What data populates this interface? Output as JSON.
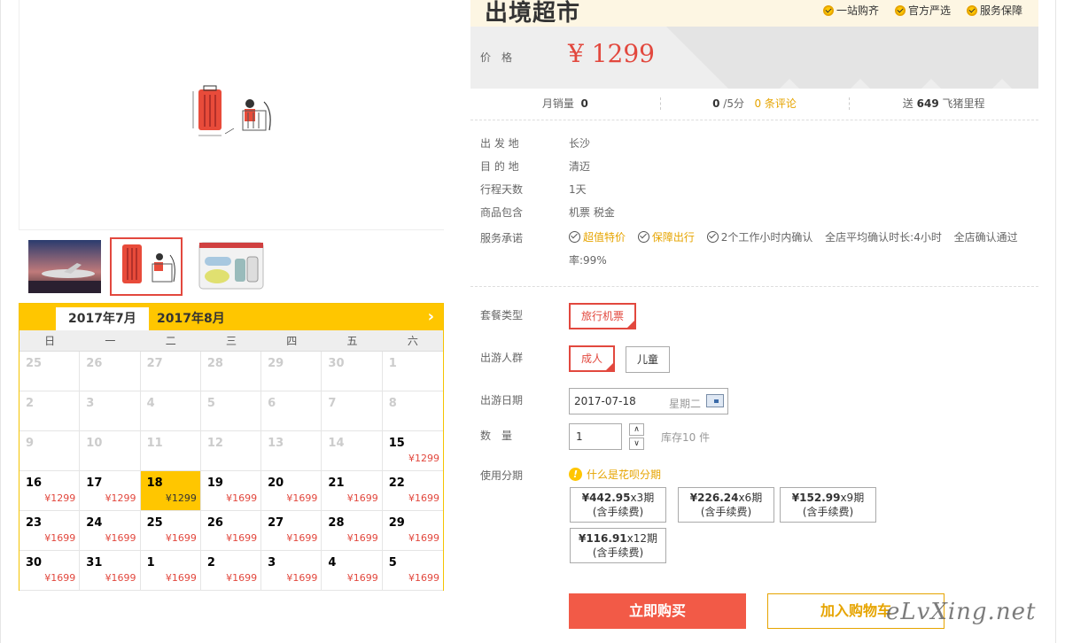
{
  "brand": {
    "logo_text": "出境超市",
    "badges": [
      "一站购齐",
      "官方严选",
      "服务保障"
    ]
  },
  "price": {
    "label": "价格",
    "value": "¥ 1299"
  },
  "stats": {
    "sales_label": "月销量",
    "sales_value": "0",
    "score_value": "0",
    "score_unit": "/5分",
    "reviews_link": "0 条评论",
    "miles_prefix": "送",
    "miles_value": "649",
    "miles_suffix": "飞猪里程"
  },
  "info": [
    {
      "key": "出 发 地",
      "value": "长沙"
    },
    {
      "key": "目 的 地",
      "value": "清迈"
    },
    {
      "key": "行程天数",
      "value": "1天"
    },
    {
      "key": "商品包含",
      "value": "机票  税金"
    }
  ],
  "promise": {
    "label": "服务承诺",
    "items": [
      {
        "text": "超值特价",
        "highlight": true,
        "icon": "check-circle-icon"
      },
      {
        "text": "保障出行",
        "highlight": true,
        "icon": "check-circle-icon"
      },
      {
        "text": "2个工作小时内确认",
        "highlight": false,
        "icon": "check-circle-icon"
      }
    ],
    "extra1": "全店平均确认时长:4小时",
    "extra2": "全店确认通过率:99%"
  },
  "options": {
    "package_label": "套餐类型",
    "package_value": "旅行机票",
    "crowd_label": "出游人群",
    "crowd_adult": "成人",
    "crowd_child": "儿童",
    "date_label": "出游日期",
    "date_value": "2017-07-18",
    "date_weekday": "星期二",
    "qty_label": "数　量",
    "qty_value": "1",
    "stock": "库存10 件",
    "installment_label": "使用分期",
    "huabei_link": "什么是花呗分期",
    "installments": [
      {
        "amount": "¥442.95",
        "term": "x3期",
        "fee": "(含手续费)"
      },
      {
        "amount": "¥226.24",
        "term": "x6期",
        "fee": "(含手续费)"
      },
      {
        "amount": "¥152.99",
        "term": "x9期",
        "fee": "(含手续费)"
      },
      {
        "amount": "¥116.91",
        "term": "x12期",
        "fee": "(含手续费)"
      }
    ]
  },
  "actions": {
    "buy": "立即购买",
    "cart": "加入购物车"
  },
  "watermark": "eLvXing.net",
  "calendar": {
    "tab_active": "2017年7月",
    "tab_other": "2017年8月",
    "next_icon": "chevron-right-icon",
    "weekdays": [
      "日",
      "一",
      "二",
      "三",
      "四",
      "五",
      "六"
    ],
    "days": [
      {
        "d": "25",
        "p": ""
      },
      {
        "d": "26",
        "p": ""
      },
      {
        "d": "27",
        "p": ""
      },
      {
        "d": "28",
        "p": ""
      },
      {
        "d": "29",
        "p": ""
      },
      {
        "d": "30",
        "p": ""
      },
      {
        "d": "1",
        "p": ""
      },
      {
        "d": "2",
        "p": ""
      },
      {
        "d": "3",
        "p": ""
      },
      {
        "d": "4",
        "p": ""
      },
      {
        "d": "5",
        "p": ""
      },
      {
        "d": "6",
        "p": ""
      },
      {
        "d": "7",
        "p": ""
      },
      {
        "d": "8",
        "p": ""
      },
      {
        "d": "9",
        "p": ""
      },
      {
        "d": "10",
        "p": ""
      },
      {
        "d": "11",
        "p": ""
      },
      {
        "d": "12",
        "p": ""
      },
      {
        "d": "13",
        "p": ""
      },
      {
        "d": "14",
        "p": ""
      },
      {
        "d": "15",
        "p": "¥1299"
      },
      {
        "d": "16",
        "p": "¥1299"
      },
      {
        "d": "17",
        "p": "¥1299"
      },
      {
        "d": "18",
        "p": "¥1299",
        "selected": true
      },
      {
        "d": "19",
        "p": "¥1699"
      },
      {
        "d": "20",
        "p": "¥1699"
      },
      {
        "d": "21",
        "p": "¥1699"
      },
      {
        "d": "22",
        "p": "¥1699"
      },
      {
        "d": "23",
        "p": "¥1699"
      },
      {
        "d": "24",
        "p": "¥1699"
      },
      {
        "d": "25",
        "p": "¥1699"
      },
      {
        "d": "26",
        "p": "¥1699"
      },
      {
        "d": "27",
        "p": "¥1699"
      },
      {
        "d": "28",
        "p": "¥1699"
      },
      {
        "d": "29",
        "p": "¥1699"
      },
      {
        "d": "30",
        "p": "¥1699"
      },
      {
        "d": "31",
        "p": "¥1699"
      },
      {
        "d": "1",
        "p": "¥1699"
      },
      {
        "d": "2",
        "p": "¥1699"
      },
      {
        "d": "3",
        "p": "¥1699"
      },
      {
        "d": "4",
        "p": "¥1699"
      },
      {
        "d": "5",
        "p": "¥1699"
      }
    ]
  },
  "colors": {
    "accent_red": "#e2483e",
    "accent_yellow": "#ffc600",
    "accent_orange": "#e6a400"
  }
}
